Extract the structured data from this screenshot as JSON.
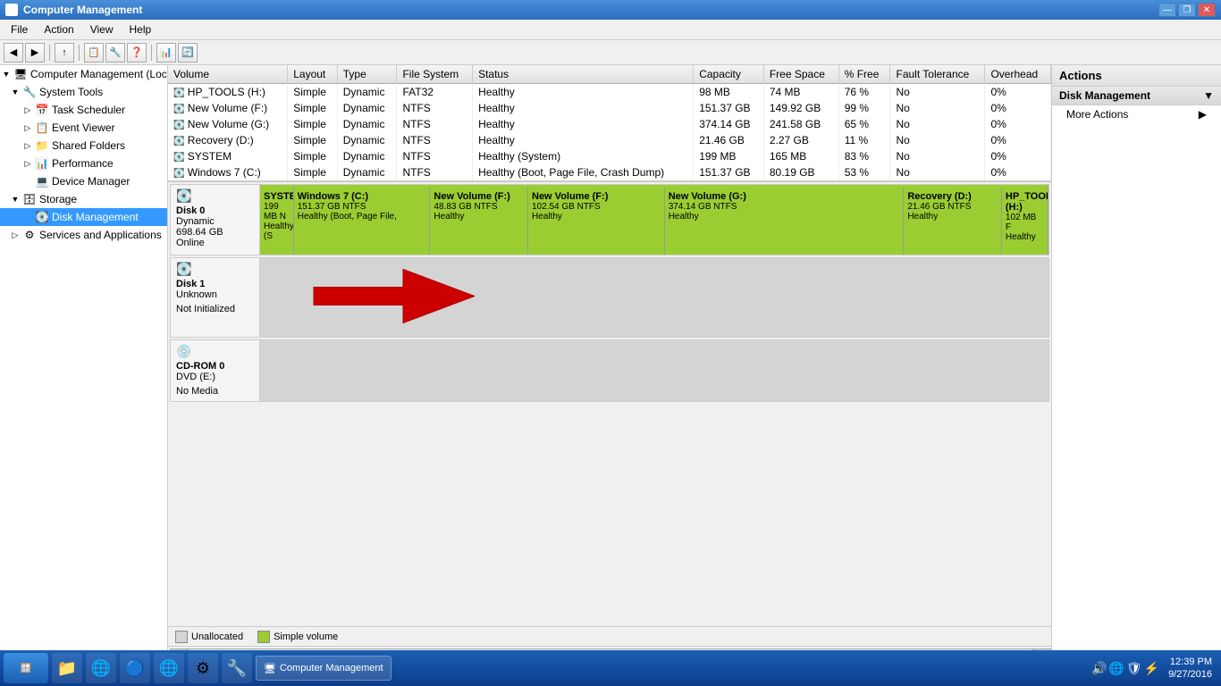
{
  "titleBar": {
    "title": "Computer Management",
    "minimize": "—",
    "restore": "❐",
    "close": "✕"
  },
  "menuBar": {
    "items": [
      "File",
      "Action",
      "View",
      "Help"
    ]
  },
  "treePanel": {
    "title": "Computer Management (Local",
    "items": [
      {
        "label": "Computer Management (Local",
        "level": 0,
        "icon": "🖥",
        "arrow": "▼",
        "bold": true
      },
      {
        "label": "System Tools",
        "level": 1,
        "icon": "🔧",
        "arrow": "▼"
      },
      {
        "label": "Task Scheduler",
        "level": 2,
        "icon": "📅",
        "arrow": "▷"
      },
      {
        "label": "Event Viewer",
        "level": 2,
        "icon": "📋",
        "arrow": "▷"
      },
      {
        "label": "Shared Folders",
        "level": 2,
        "icon": "📁",
        "arrow": "▷"
      },
      {
        "label": "Performance",
        "level": 2,
        "icon": "📊",
        "arrow": "▷"
      },
      {
        "label": "Device Manager",
        "level": 2,
        "icon": "💻",
        "arrow": ""
      },
      {
        "label": "Storage",
        "level": 1,
        "icon": "🗄",
        "arrow": "▼"
      },
      {
        "label": "Disk Management",
        "level": 2,
        "icon": "💽",
        "arrow": "",
        "selected": true
      },
      {
        "label": "Services and Applications",
        "level": 1,
        "icon": "⚙",
        "arrow": "▷"
      }
    ]
  },
  "tableHeaders": [
    "Volume",
    "Layout",
    "Type",
    "File System",
    "Status",
    "Capacity",
    "Free Space",
    "% Free",
    "Fault Tolerance",
    "Overhead"
  ],
  "tableRows": [
    {
      "volume": "HP_TOOLS (H:)",
      "layout": "Simple",
      "type": "Dynamic",
      "fs": "FAT32",
      "status": "Healthy",
      "capacity": "98 MB",
      "free": "74 MB",
      "pct": "76 %",
      "fault": "No",
      "overhead": "0%"
    },
    {
      "volume": "New Volume (F:)",
      "layout": "Simple",
      "type": "Dynamic",
      "fs": "NTFS",
      "status": "Healthy",
      "capacity": "151.37 GB",
      "free": "149.92 GB",
      "pct": "99 %",
      "fault": "No",
      "overhead": "0%"
    },
    {
      "volume": "New Volume (G:)",
      "layout": "Simple",
      "type": "Dynamic",
      "fs": "NTFS",
      "status": "Healthy",
      "capacity": "374.14 GB",
      "free": "241.58 GB",
      "pct": "65 %",
      "fault": "No",
      "overhead": "0%"
    },
    {
      "volume": "Recovery (D:)",
      "layout": "Simple",
      "type": "Dynamic",
      "fs": "NTFS",
      "status": "Healthy",
      "capacity": "21.46 GB",
      "free": "2.27 GB",
      "pct": "11 %",
      "fault": "No",
      "overhead": "0%"
    },
    {
      "volume": "SYSTEM",
      "layout": "Simple",
      "type": "Dynamic",
      "fs": "NTFS",
      "status": "Healthy (System)",
      "capacity": "199 MB",
      "free": "165 MB",
      "pct": "83 %",
      "fault": "No",
      "overhead": "0%"
    },
    {
      "volume": "Windows 7 (C:)",
      "layout": "Simple",
      "type": "Dynamic",
      "fs": "NTFS",
      "status": "Healthy (Boot, Page File, Crash Dump)",
      "capacity": "151.37 GB",
      "free": "80.19 GB",
      "pct": "53 %",
      "fault": "No",
      "overhead": "0%"
    }
  ],
  "disk0": {
    "label": "Disk 0",
    "type": "Dynamic",
    "size": "698.64 GB",
    "status": "Online",
    "partitions": [
      {
        "name": "SYSTEM",
        "detail1": "199 MB N",
        "detail2": "Healthy (S"
      },
      {
        "name": "Windows 7  (C:)",
        "detail1": "151.37 GB NTFS",
        "detail2": "Healthy (Boot, Page File,"
      },
      {
        "name": "New Volume  (F:)",
        "detail1": "48.83 GB NTFS",
        "detail2": "Healthy"
      },
      {
        "name": "New Volume  (F:)",
        "detail1": "102.54 GB NTFS",
        "detail2": "Healthy"
      },
      {
        "name": "New Volume  (G:)",
        "detail1": "374.14 GB NTFS",
        "detail2": "Healthy"
      },
      {
        "name": "Recovery  (D:)",
        "detail1": "21.46 GB NTFS",
        "detail2": "Healthy"
      },
      {
        "name": "HP_TOOLS  (H:)",
        "detail1": "102 MB F",
        "detail2": "Healthy"
      }
    ]
  },
  "disk1": {
    "label": "Disk 1",
    "type": "Unknown",
    "status": "Not Initialized"
  },
  "cdrom": {
    "label": "CD-ROM 0",
    "type": "DVD (E:)",
    "status": "No Media"
  },
  "legend": {
    "items": [
      {
        "color": "#d4d4d4",
        "label": "Unallocated"
      },
      {
        "color": "#9acd32",
        "label": "Simple volume"
      }
    ]
  },
  "actionsPanel": {
    "header": "Actions",
    "sections": [
      {
        "label": "Disk Management",
        "items": [
          "More Actions"
        ]
      }
    ]
  },
  "taskbar": {
    "time": "12:39 PM",
    "date": "9/27/2016",
    "apps": [
      {
        "icon": "🪟",
        "label": "Start"
      },
      {
        "icon": "📁"
      },
      {
        "icon": "🌐"
      },
      {
        "icon": "🔵"
      },
      {
        "icon": "🌐"
      },
      {
        "icon": "⚙"
      },
      {
        "icon": "🔧"
      }
    ],
    "activeTask": "Computer Management"
  }
}
